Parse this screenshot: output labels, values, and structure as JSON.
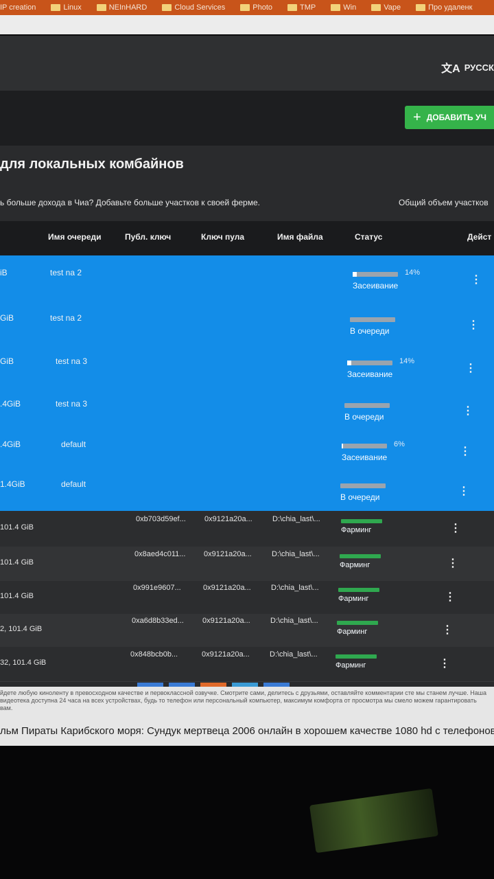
{
  "bookmarks": [
    "IP creation",
    "Linux",
    "NEInHARD",
    "Cloud Services",
    "Photo",
    "TMP",
    "Win",
    "Vape",
    "Про удаленк"
  ],
  "header": {
    "language": "РУССК"
  },
  "toolbar": {
    "add_label": "ДОБАВИТЬ УЧ"
  },
  "section": {
    "title": "для локальных комбайнов",
    "subtitle": "ь больше дохода в Чиа? Добавьте больше участков к своей ферме.",
    "total_label": "Общий объем участков"
  },
  "table": {
    "headers": [
      "Имя очереди",
      "Публ. ключ",
      "Ключ пула",
      "Имя файла",
      "Статус",
      "Дейст"
    ],
    "queue_rows": [
      {
        "size": "iB",
        "queue": "test na 2",
        "progress": 14,
        "pct": "14%",
        "status": "Засеивание"
      },
      {
        "size": "GiB",
        "queue": "test na 2",
        "progress": 0,
        "pct": "",
        "status": "В очереди"
      },
      {
        "size": "GiB",
        "queue": "test na 3",
        "progress": 14,
        "pct": "14%",
        "status": "Засеивание"
      },
      {
        "size": ".4GiB",
        "queue": "test na 3",
        "progress": 0,
        "pct": "",
        "status": "В очереди"
      },
      {
        "size": ".4GiB",
        "queue": "default",
        "progress": 6,
        "pct": "6%",
        "status": "Засеивание"
      },
      {
        "size": "1.4GiB",
        "queue": "default",
        "progress": 0,
        "pct": "",
        "status": "В очереди"
      }
    ],
    "farm_rows": [
      {
        "size": "101.4 GiB",
        "pub": "0xb703d59ef...",
        "pool": "0x9121a20a...",
        "file": "D:\\chia_last\\...",
        "status": "Фарминг"
      },
      {
        "size": "101.4 GiB",
        "pub": "0x8aed4c011...",
        "pool": "0x9121a20a...",
        "file": "D:\\chia_last\\...",
        "status": "Фарминг"
      },
      {
        "size": "101.4 GiB",
        "pub": "0x991e9607...",
        "pool": "0x9121a20a...",
        "file": "D:\\chia_last\\...",
        "status": "Фарминг"
      },
      {
        "size": "2, 101.4 GiB",
        "pub": "0xa6d8b33ed...",
        "pool": "0x9121a20a...",
        "file": "D:\\chia_last\\...",
        "status": "Фарминг"
      },
      {
        "size": "32, 101.4 GiB",
        "pub": "0x848bcb0b...",
        "pool": "0x9121a20a...",
        "file": "D:\\chia_last\\...",
        "status": "Фарминг"
      }
    ]
  },
  "below_page": {
    "small_text": "йдете любую киноленту в превосходном качестве и первоклассной озвучке. Смотрите сами, делитесь с друзьями, оставляйте комментарии сте мы станем лучше. Наша видеотека доступна 24 часа на всех устройствах, будь то телефон или персональный компьютер, максимум комфорта от просмотра мы смело можем гарантировать вам.",
    "big_text": "льм Пираты Карибского моря: Сундук мертвеца 2006 онлайн в хорошем качестве 1080 hd с телефонов и"
  },
  "colors": {
    "blue_row": "#138de8",
    "add_button": "#35b34a",
    "farm_green": "#2fa84f"
  }
}
